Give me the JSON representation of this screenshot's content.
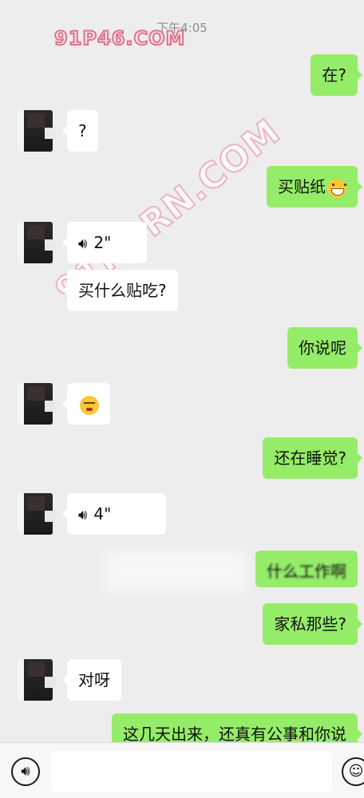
{
  "watermarks": {
    "top": "91P46.COM",
    "diagonal": "91PORN.COM"
  },
  "timestamp": "下午4:05",
  "messages": [
    {
      "side": "out",
      "type": "text",
      "text": "在?"
    },
    {
      "side": "in",
      "type": "text",
      "text": "?"
    },
    {
      "side": "out",
      "type": "text",
      "text": "买贴纸",
      "emoji": "grinning-face"
    },
    {
      "side": "in",
      "type": "voice",
      "duration": "2\""
    },
    {
      "side": "in",
      "type": "text",
      "text": "买什么贴吃?"
    },
    {
      "side": "out",
      "type": "text",
      "text": "你说呢"
    },
    {
      "side": "in",
      "type": "emoji",
      "emoji": "tired-face"
    },
    {
      "side": "out",
      "type": "text",
      "text": "还在睡觉?"
    },
    {
      "side": "in",
      "type": "voice",
      "duration": "4\""
    },
    {
      "side": "out",
      "type": "text",
      "text": "什么工作啊"
    },
    {
      "side": "out",
      "type": "text",
      "text": "家私那些?"
    },
    {
      "side": "in",
      "type": "text",
      "text": "对呀"
    },
    {
      "side": "out",
      "type": "text",
      "text": "这几天出来，还真有公事和你说"
    }
  ],
  "input": {
    "placeholder": ""
  },
  "icons": {
    "voice": "voice-icon",
    "emoji": "smile-icon"
  },
  "colors": {
    "outgoing_bubble": "#95ec69",
    "incoming_bubble": "#ffffff",
    "background": "#ededed"
  }
}
